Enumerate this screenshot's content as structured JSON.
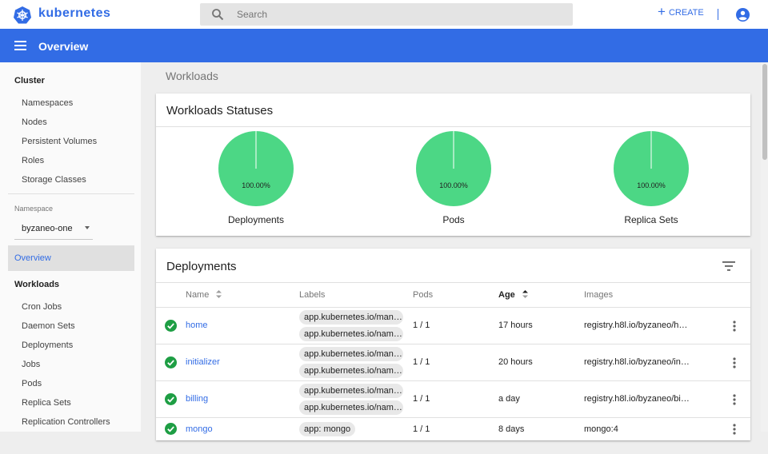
{
  "header": {
    "brand": "kubernetes",
    "search_placeholder": "Search",
    "create_label": "CREATE",
    "brand_color": "#326ce5"
  },
  "appbar": {
    "title": "Overview"
  },
  "sidebar": {
    "cluster_heading": "Cluster",
    "cluster_items": [
      "Namespaces",
      "Nodes",
      "Persistent Volumes",
      "Roles",
      "Storage Classes"
    ],
    "namespace_label": "Namespace",
    "namespace_value": "byzaneo-one",
    "overview_label": "Overview",
    "workloads_heading": "Workloads",
    "workload_items": [
      "Cron Jobs",
      "Daemon Sets",
      "Deployments",
      "Jobs",
      "Pods",
      "Replica Sets",
      "Replication Controllers"
    ]
  },
  "main": {
    "section_title": "Workloads",
    "statuses": {
      "title": "Workloads Statuses",
      "charts": [
        {
          "label": "Deployments",
          "percent": "100.00%",
          "running_fraction": 1.0
        },
        {
          "label": "Pods",
          "percent": "100.00%",
          "running_fraction": 1.0
        },
        {
          "label": "Replica Sets",
          "percent": "100.00%",
          "running_fraction": 1.0
        }
      ],
      "running_color": "#4cd785"
    },
    "deployments": {
      "title": "Deployments",
      "columns": [
        "Name",
        "Labels",
        "Pods",
        "Age",
        "Images"
      ],
      "rows": [
        {
          "name": "home",
          "labels": [
            "app.kubernetes.io/mana…",
            "app.kubernetes.io/name: …"
          ],
          "pods": "1 / 1",
          "age": "17 hours",
          "image": "registry.h8l.io/byzaneo/h…"
        },
        {
          "name": "initializer",
          "labels": [
            "app.kubernetes.io/mana…",
            "app.kubernetes.io/name: …"
          ],
          "pods": "1 / 1",
          "age": "20 hours",
          "image": "registry.h8l.io/byzaneo/in…"
        },
        {
          "name": "billing",
          "labels": [
            "app.kubernetes.io/mana…",
            "app.kubernetes.io/name: …"
          ],
          "pods": "1 / 1",
          "age": "a day",
          "image": "registry.h8l.io/byzaneo/bi…"
        },
        {
          "name": "mongo",
          "labels": [
            "app: mongo"
          ],
          "pods": "1 / 1",
          "age": "8 days",
          "image": "mongo:4"
        }
      ],
      "status_color": "#1e9e44"
    }
  }
}
